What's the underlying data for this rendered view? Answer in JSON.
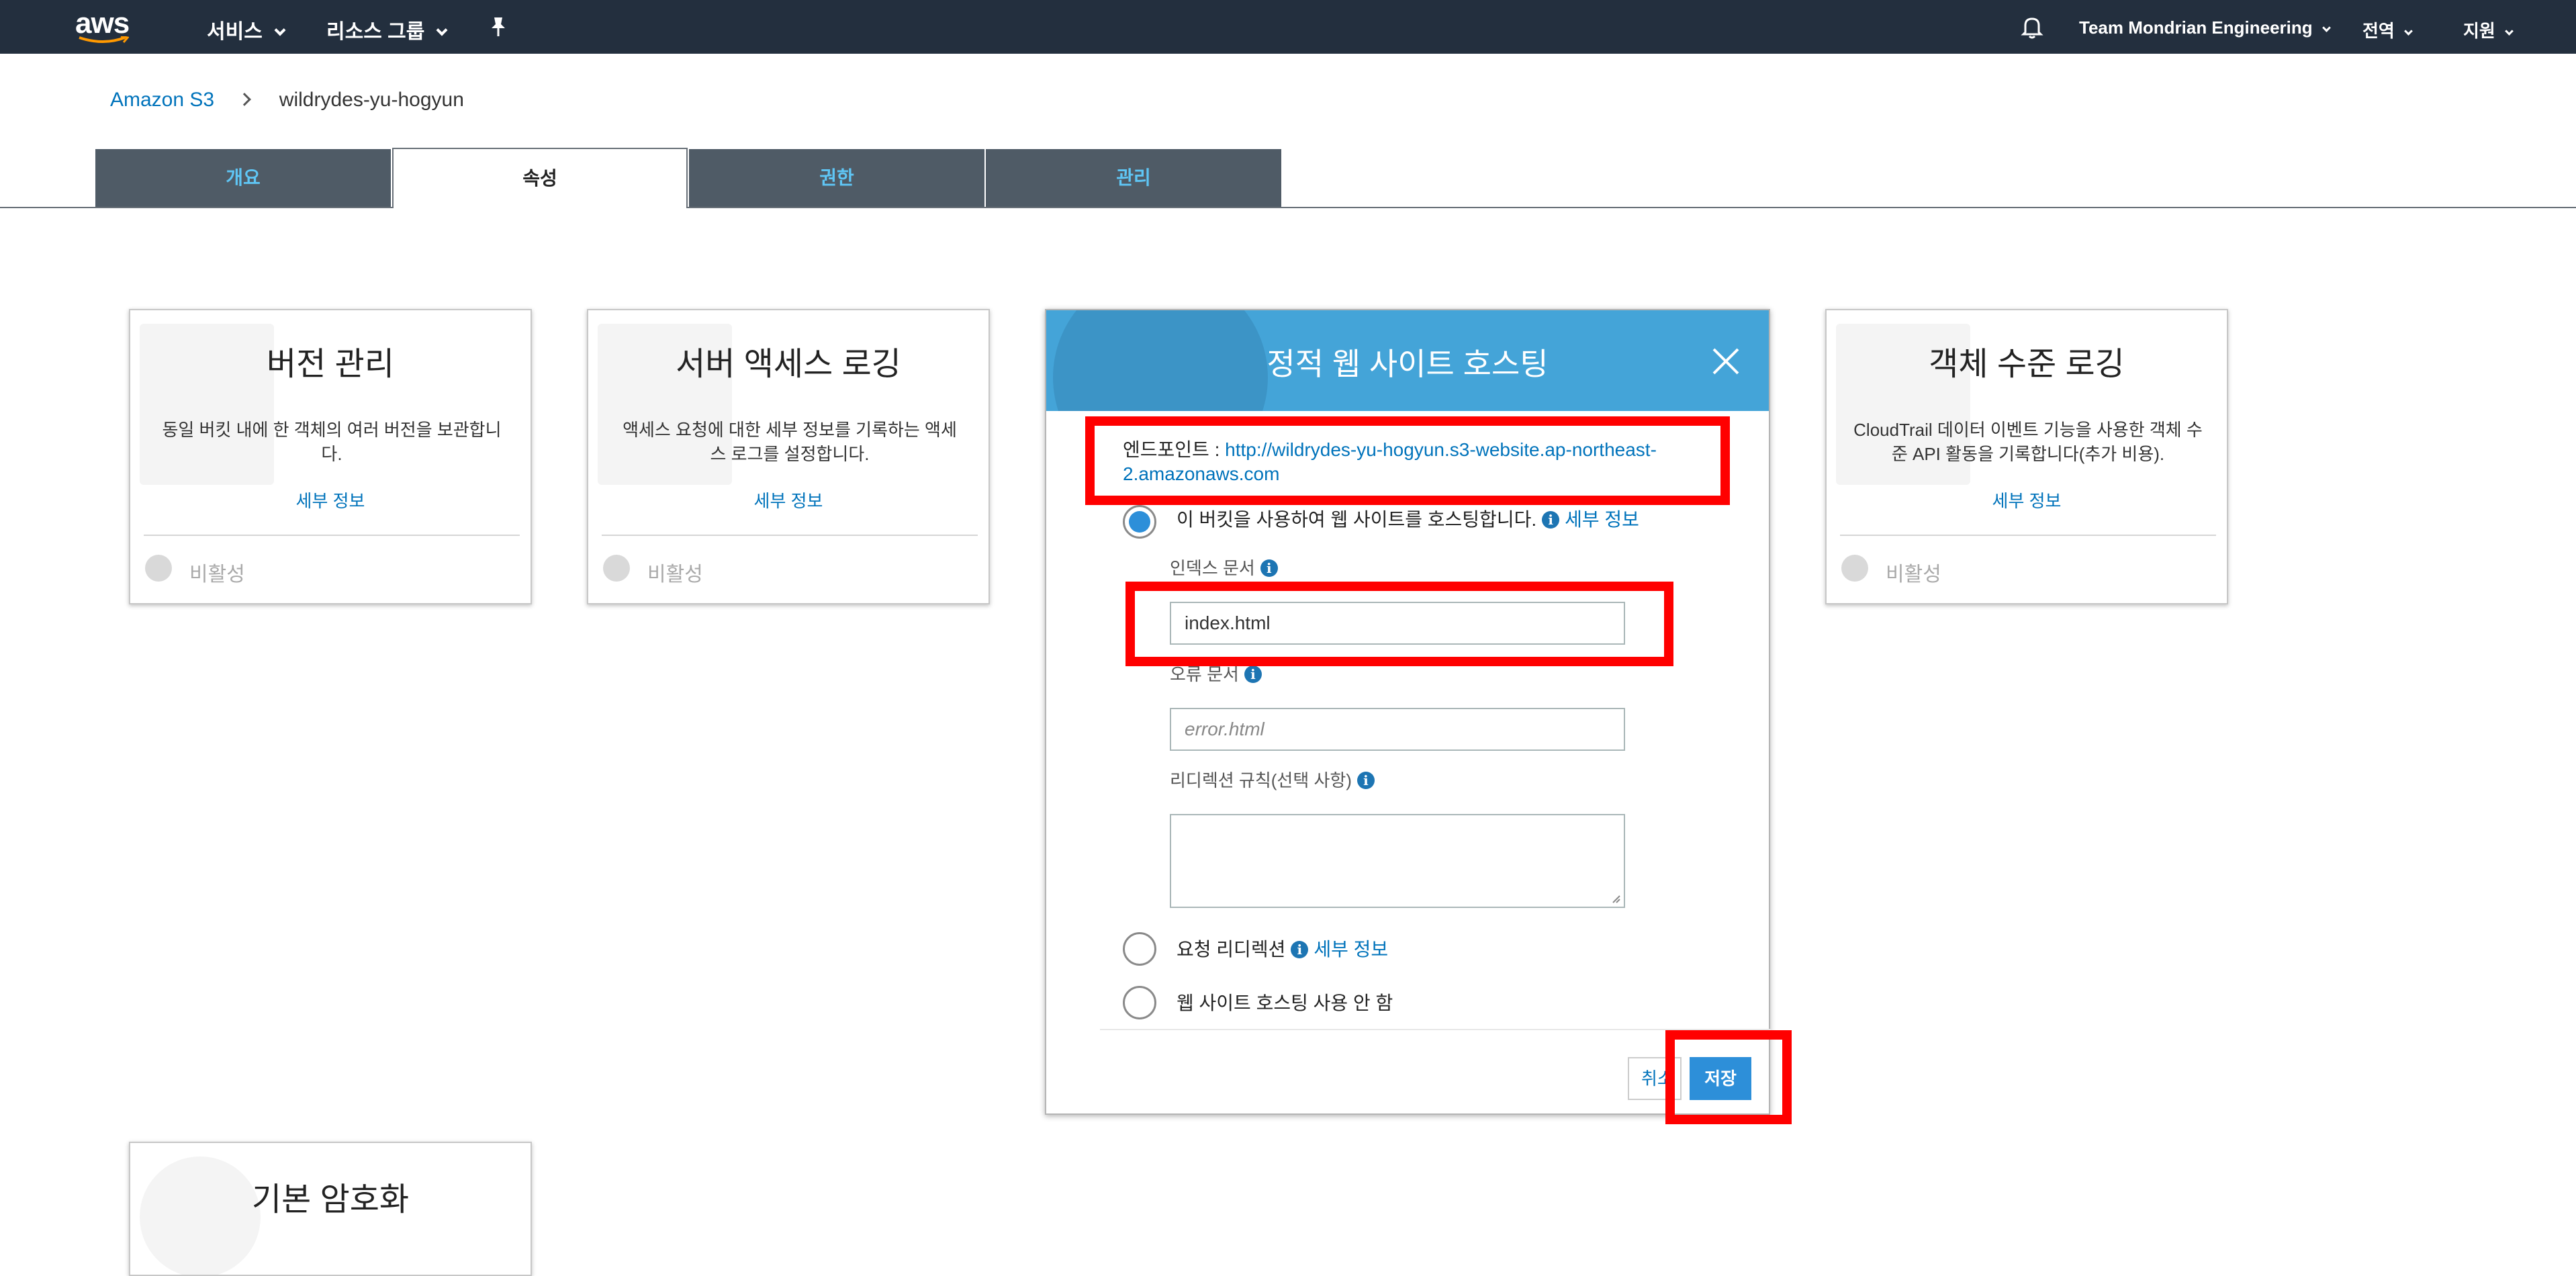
{
  "topnav": {
    "logo": "aws",
    "services": "서비스",
    "resource_groups": "리소스 그룹",
    "account": "Team Mondrian Engineering",
    "region": "전역",
    "support": "지원",
    "icons": [
      "pin-icon",
      "bell-icon"
    ]
  },
  "breadcrumb": {
    "root": "Amazon S3",
    "current": "wildrydes-yu-hogyun"
  },
  "tabs": [
    {
      "label": "개요",
      "active": false
    },
    {
      "label": "속성",
      "active": true
    },
    {
      "label": "권한",
      "active": false
    },
    {
      "label": "관리",
      "active": false
    }
  ],
  "cards": [
    {
      "title": "버전 관리",
      "description": "동일 버킷 내에 한 객체의 여러 버전을 보관합니다.",
      "link": "세부 정보",
      "status": "비활성"
    },
    {
      "title": "서버 액세스 로깅",
      "description": "액세스 요청에 대한 세부 정보를 기록하는 액세스 로그를 설정합니다.",
      "link": "세부 정보",
      "status": "비활성"
    },
    {
      "title": "객체 수준 로깅",
      "description": "CloudTrail 데이터 이벤트 기능을 사용한 객체 수준 API 활동을 기록합니다(추가 비용).",
      "link": "세부 정보",
      "status": "비활성"
    },
    {
      "title": "기본 암호화"
    }
  ],
  "modal": {
    "title": "정적 웹 사이트 호스팅",
    "endpoint_label": "엔드포인트 : ",
    "endpoint_url": "http://wildrydes-yu-hogyun.s3-website.ap-northeast-2.amazonaws.com",
    "option_host": "이 버킷을 사용하여 웹 사이트를 호스팅합니다.",
    "details_link": "세부 정보",
    "index_label": "인덱스 문서",
    "index_value": "index.html",
    "error_label": "오류 문서",
    "error_placeholder": "error.html",
    "redirect_rules_label": "리디렉션 규칙(선택 사항)",
    "option_redirect": "요청 리디렉션",
    "option_disable": "웹 사이트 호스팅 사용 안 함",
    "cancel": "취소",
    "save": "저장",
    "selected_option": "host"
  },
  "colors": {
    "nav_bg": "#232f3e",
    "tab_bg": "#4f5b66",
    "tab_text": "#5fc6f5",
    "modal_header": "#44a4d8",
    "link": "#0073bb",
    "primary_button": "#2d8fd9",
    "highlight": "#ff0000"
  }
}
